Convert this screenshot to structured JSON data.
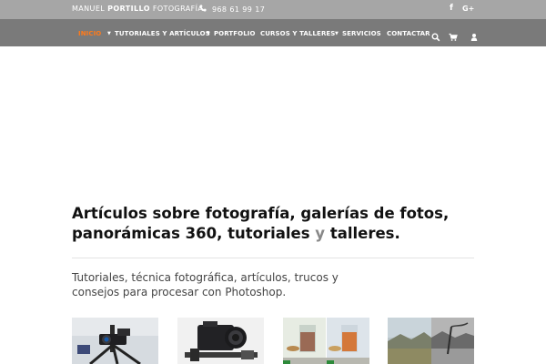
{
  "topbar": {
    "brand_first": "MANUEL",
    "brand_bold": "PORTILLO",
    "brand_last": "FOTOGRAFÍA",
    "phone_icon": "phone-icon",
    "phone": "968 61 99 17",
    "social": [
      {
        "name": "facebook-icon",
        "glyph": "f"
      },
      {
        "name": "google-plus-icon",
        "glyph": "G+"
      }
    ]
  },
  "nav": {
    "items": [
      {
        "label": "INICIO",
        "dropdown": false,
        "active": true
      },
      {
        "label": "TUTORIALES Y ARTÍCULOS",
        "dropdown": true,
        "active": false
      },
      {
        "label": "PORTFOLIO",
        "dropdown": true,
        "active": false
      },
      {
        "label": "CURSOS Y TALLERES",
        "dropdown": false,
        "active": false
      },
      {
        "label": "SERVICIOS",
        "dropdown": true,
        "active": false
      },
      {
        "label": "CONTACTAR",
        "dropdown": false,
        "active": false
      }
    ],
    "icons": [
      "search-icon",
      "cart-icon",
      "user-icon"
    ],
    "active_color": "#ff7a1a"
  },
  "main": {
    "headline_part1": "Artículos sobre fotografía, galerías de fotos, panorámicas 360, tutoriales",
    "headline_accent": "y",
    "headline_part2": "talleres.",
    "subtext": "Tutoriales, técnica fotográfica, artículos, trucos y consejos para procesar con Photoshop."
  },
  "thumbnails": [
    {
      "name": "thumb-camera-tripod"
    },
    {
      "name": "thumb-camera-macro-rail"
    },
    {
      "name": "thumb-drinks-comparison"
    },
    {
      "name": "thumb-landscape-bw"
    }
  ],
  "colors": {
    "topbar_bg": "#a6a6a6",
    "navbar_bg": "#7a7a7a",
    "accent": "#ff7a1a"
  }
}
